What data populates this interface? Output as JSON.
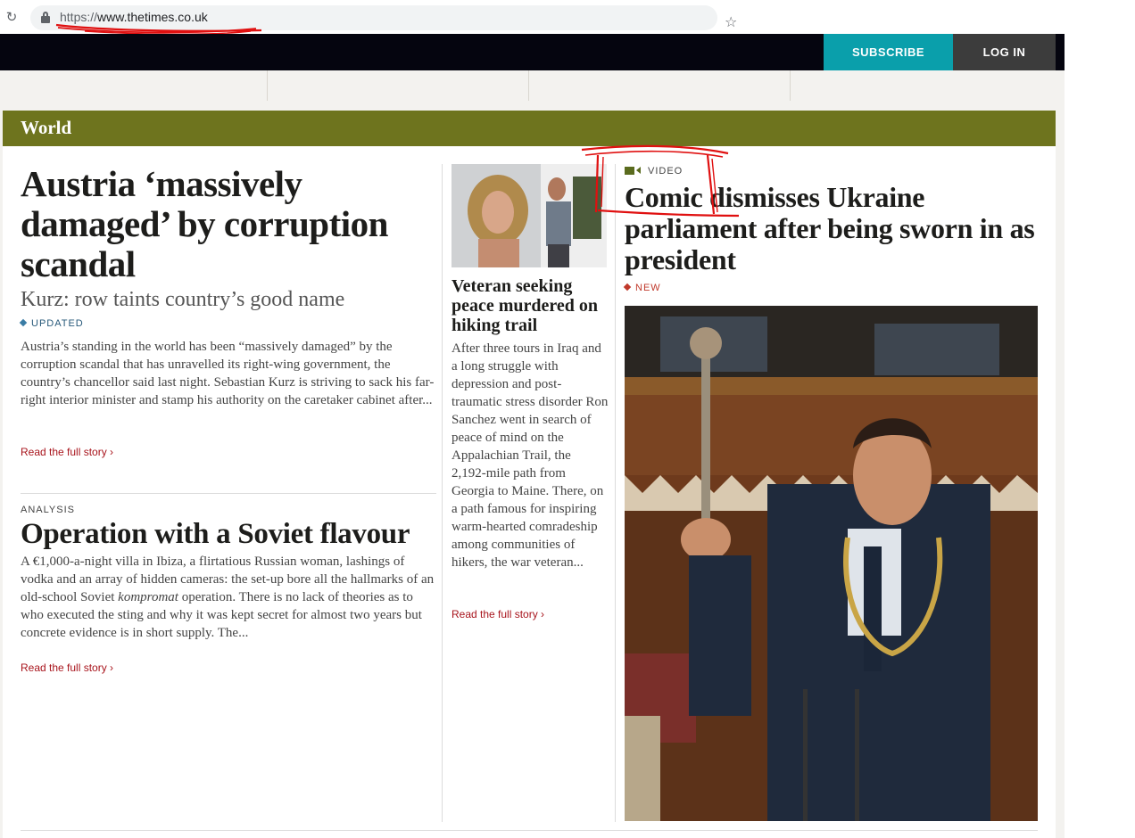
{
  "browser": {
    "url_scheme": "https://",
    "url_host": "www.thetimes.co.uk"
  },
  "header": {
    "subscribe_label": "SUBSCRIBE",
    "login_label": "LOG IN"
  },
  "section": {
    "title": "World"
  },
  "lead": {
    "headline": "Austria ‘massively damaged’ by corruption scandal",
    "subhead": "Kurz: row taints country’s good name",
    "tag": "UPDATED",
    "body": "Austria’s standing in the world has been “massively damaged” by the corruption scandal that has unravelled its right-wing government, the country’s chancellor said last night. Sebastian Kurz is striving to sack his far-right interior minister and stamp his authority on the caretaker cabinet after...",
    "read_more": "Read the full story"
  },
  "second": {
    "kicker": "ANALYSIS",
    "headline": "Operation with a Soviet flavour",
    "body_pre": "A €1,000-a-night villa in Ibiza, a flirtatious Russian woman, lashings of vodka and an array of hidden cameras: the set-up bore all the hallmarks of an old-school Soviet ",
    "body_em": "kompromat",
    "body_post": " operation. There is no lack of theories as to who executed the sting and why it was kept secret for almost two years but concrete evidence is in short supply. The...",
    "read_more": "Read the full story"
  },
  "middle": {
    "headline": "Veteran seeking peace murdered on hiking trail",
    "body": "After three tours in Iraq and a long struggle with depression and post-traumatic stress disorder Ron Sanchez went in search of peace of mind on the Appalachian Trail, the 2,192-mile path from Georgia to Maine. There, on a path famous for inspiring warm-hearted comradeship among communities of hikers, the war veteran...",
    "read_more": "Read the full story"
  },
  "right": {
    "kicker": "VIDEO",
    "headline": "Comic dismisses Ukraine parliament after being sworn in as president",
    "tag": "NEW"
  },
  "colors": {
    "section_green": "#6e741e",
    "subscribe_teal": "#0a9fab",
    "link_red": "#a8141c",
    "updated_blue": "#27597a"
  },
  "icons": {
    "reload": "reload-icon",
    "lock": "lock-icon",
    "bookmark": "star-icon",
    "video": "video-camera-icon",
    "chevron": "chevron-right-icon"
  }
}
